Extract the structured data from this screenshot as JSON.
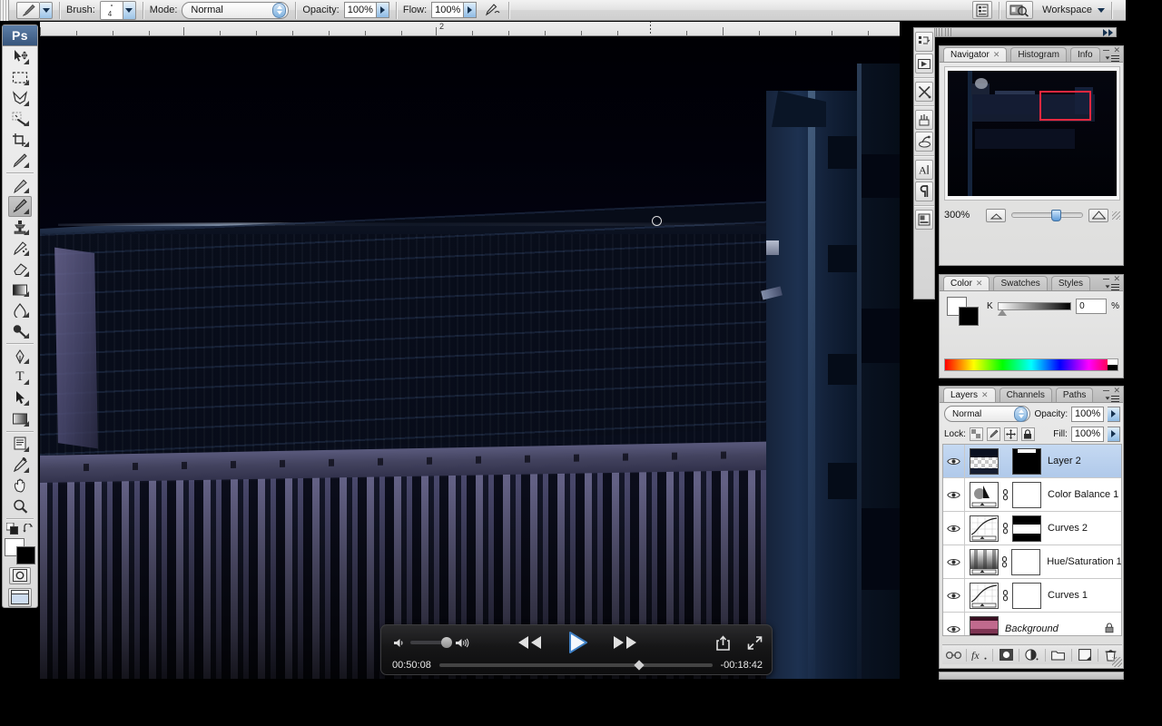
{
  "app": {
    "name": "Ps",
    "title": "Adobe Photoshop"
  },
  "options_bar": {
    "brush_label": "Brush:",
    "brush_size": "4",
    "mode_label": "Mode:",
    "mode_value": "Normal",
    "opacity_label": "Opacity:",
    "opacity_value": "100%",
    "flow_label": "Flow:",
    "flow_value": "100%",
    "airbrush_icon": "airbrush-icon",
    "tool_preset_icon": "brush-tool-icon",
    "palettes_icon": "palettes-toggle-icon",
    "bridge_icon": "go-to-bridge-icon",
    "workspace_label": "Workspace"
  },
  "toolbar": {
    "tools": [
      {
        "name": "move-tool",
        "icon": "arrow-move-icon",
        "selected": false
      },
      {
        "name": "marquee-tool",
        "icon": "rectangular-marquee-icon",
        "selected": false
      },
      {
        "name": "lasso-tool",
        "icon": "lasso-icon",
        "selected": false
      },
      {
        "name": "magic-wand-tool",
        "icon": "magic-wand-icon",
        "selected": false
      },
      {
        "name": "crop-tool",
        "icon": "crop-icon",
        "selected": false
      },
      {
        "name": "slice-tool",
        "icon": "slice-icon",
        "selected": false
      },
      {
        "name": "healing-brush-tool",
        "icon": "healing-brush-icon",
        "selected": false
      },
      {
        "name": "brush-tool",
        "icon": "paintbrush-icon",
        "selected": true
      },
      {
        "name": "clone-stamp-tool",
        "icon": "clone-stamp-icon",
        "selected": false
      },
      {
        "name": "history-brush-tool",
        "icon": "history-brush-icon",
        "selected": false
      },
      {
        "name": "eraser-tool",
        "icon": "eraser-icon",
        "selected": false
      },
      {
        "name": "gradient-tool",
        "icon": "gradient-icon",
        "selected": false
      },
      {
        "name": "blur-tool",
        "icon": "blur-drop-icon",
        "selected": false
      },
      {
        "name": "dodge-tool",
        "icon": "dodge-icon",
        "selected": false
      },
      {
        "name": "pen-tool",
        "icon": "pen-icon",
        "selected": false
      },
      {
        "name": "type-tool",
        "icon": "type-t-icon",
        "selected": false
      },
      {
        "name": "path-selection-tool",
        "icon": "path-arrow-icon",
        "selected": false
      },
      {
        "name": "shape-tool",
        "icon": "rectangle-shape-icon",
        "selected": false
      },
      {
        "name": "notes-tool",
        "icon": "notes-icon",
        "selected": false
      },
      {
        "name": "eyedropper-tool",
        "icon": "eyedropper-icon",
        "selected": false
      },
      {
        "name": "hand-tool",
        "icon": "hand-icon",
        "selected": false
      },
      {
        "name": "zoom-tool",
        "icon": "magnifier-icon",
        "selected": false
      }
    ],
    "foreground_color": "#ffffff",
    "background_color": "#000000",
    "default_colors_icon": "default-colors-icon",
    "swap_colors_icon": "swap-colors-icon",
    "quick_mask_icon": "quick-mask-icon",
    "screen_mode_icon": "screen-mode-icon"
  },
  "document": {
    "ruler_label": "2",
    "zoom_level": "300%",
    "cursor_icon": "brush-circle-cursor"
  },
  "video_player": {
    "volume_icon": "volume-low-icon",
    "volume_max_icon": "volume-high-icon",
    "rewind_icon": "rewind-icon",
    "play_icon": "play-icon",
    "forward_icon": "fast-forward-icon",
    "share_icon": "share-icon",
    "fullscreen_icon": "fullscreen-icon",
    "elapsed_time": "00:50:08",
    "remaining_time": "-00:18:42",
    "volume_level": 100,
    "progress_percent": 72
  },
  "icon_dock": {
    "buttons": [
      {
        "name": "dock-history-actions",
        "icon": "history-icon"
      },
      {
        "name": "dock-actions",
        "icon": "play-actions-icon"
      },
      {
        "name": "dock-tool-presets",
        "icon": "tools-cross-icon"
      },
      {
        "name": "dock-brushes",
        "icon": "brushes-icon"
      },
      {
        "name": "dock-clone-source",
        "icon": "clone-source-icon"
      },
      {
        "name": "dock-character",
        "icon": "character-a-icon"
      },
      {
        "name": "dock-paragraph",
        "icon": "paragraph-pilcrow-icon"
      },
      {
        "name": "dock-layer-comps",
        "icon": "layer-comps-icon"
      }
    ]
  },
  "navigator_panel": {
    "tabs": [
      {
        "label": "Navigator",
        "active": true,
        "closable": true
      },
      {
        "label": "Histogram",
        "active": false,
        "closable": false
      },
      {
        "label": "Info",
        "active": false,
        "closable": false
      }
    ],
    "zoom_value": "300%",
    "zoom_out_icon": "zoom-out-small-icon",
    "zoom_in_icon": "zoom-in-large-icon",
    "view_box_color": "#e8283f",
    "menu_icon": "panel-menu-icon",
    "minimize_icon": "minimize-icon",
    "close_icon": "close-icon"
  },
  "color_panel": {
    "tabs": [
      {
        "label": "Color",
        "active": true,
        "closable": true
      },
      {
        "label": "Swatches",
        "active": false,
        "closable": false
      },
      {
        "label": "Styles",
        "active": false,
        "closable": false
      }
    ],
    "channel_label": "K",
    "channel_value": "0",
    "percent_symbol": "%",
    "foreground_color": "#ffffff",
    "background_color": "#000000",
    "menu_icon": "panel-menu-icon"
  },
  "layers_panel": {
    "tabs": [
      {
        "label": "Layers",
        "active": true,
        "closable": true
      },
      {
        "label": "Channels",
        "active": false,
        "closable": false
      },
      {
        "label": "Paths",
        "active": false,
        "closable": false
      }
    ],
    "blend_mode": "Normal",
    "opacity_label": "Opacity:",
    "opacity_value": "100%",
    "lock_label": "Lock:",
    "fill_label": "Fill:",
    "fill_value": "100%",
    "lock_buttons": [
      {
        "name": "lock-transparent-pixels",
        "icon": "checker-square-icon"
      },
      {
        "name": "lock-image-pixels",
        "icon": "brush-small-icon"
      },
      {
        "name": "lock-position",
        "icon": "move-cross-icon"
      },
      {
        "name": "lock-all",
        "icon": "padlock-icon"
      }
    ],
    "layers": [
      {
        "name": "Layer 2",
        "selected": true,
        "visible": true,
        "locked": false,
        "italic": false,
        "thumb_type": "checker",
        "has_mask": true,
        "mask_type": "black",
        "linked": false
      },
      {
        "name": "Color Balance 1",
        "selected": false,
        "visible": true,
        "locked": false,
        "italic": false,
        "thumb_type": "color-balance",
        "has_mask": true,
        "mask_type": "white",
        "linked": true
      },
      {
        "name": "Curves 2",
        "selected": false,
        "visible": true,
        "locked": false,
        "italic": false,
        "thumb_type": "curves",
        "has_mask": true,
        "mask_type": "split",
        "linked": true
      },
      {
        "name": "Hue/Saturation 1",
        "selected": false,
        "visible": true,
        "locked": false,
        "italic": false,
        "thumb_type": "hue-sat",
        "has_mask": true,
        "mask_type": "white",
        "linked": true
      },
      {
        "name": "Curves 1",
        "selected": false,
        "visible": true,
        "locked": false,
        "italic": false,
        "thumb_type": "curves",
        "has_mask": true,
        "mask_type": "white",
        "linked": true
      },
      {
        "name": "Background",
        "selected": false,
        "visible": true,
        "locked": true,
        "italic": true,
        "thumb_type": "photo",
        "has_mask": false,
        "mask_type": "",
        "linked": false
      }
    ],
    "bottom_buttons": [
      {
        "name": "link-layers-button",
        "icon": "link-icon"
      },
      {
        "name": "layer-style-button",
        "icon": "fx-icon"
      },
      {
        "name": "add-layer-mask-button",
        "icon": "mask-icon"
      },
      {
        "name": "new-adjustment-layer-button",
        "icon": "half-circle-icon"
      },
      {
        "name": "new-group-button",
        "icon": "folder-icon"
      },
      {
        "name": "new-layer-button",
        "icon": "new-layer-icon"
      },
      {
        "name": "delete-layer-button",
        "icon": "trash-icon"
      }
    ],
    "menu_icon": "panel-menu-icon"
  }
}
